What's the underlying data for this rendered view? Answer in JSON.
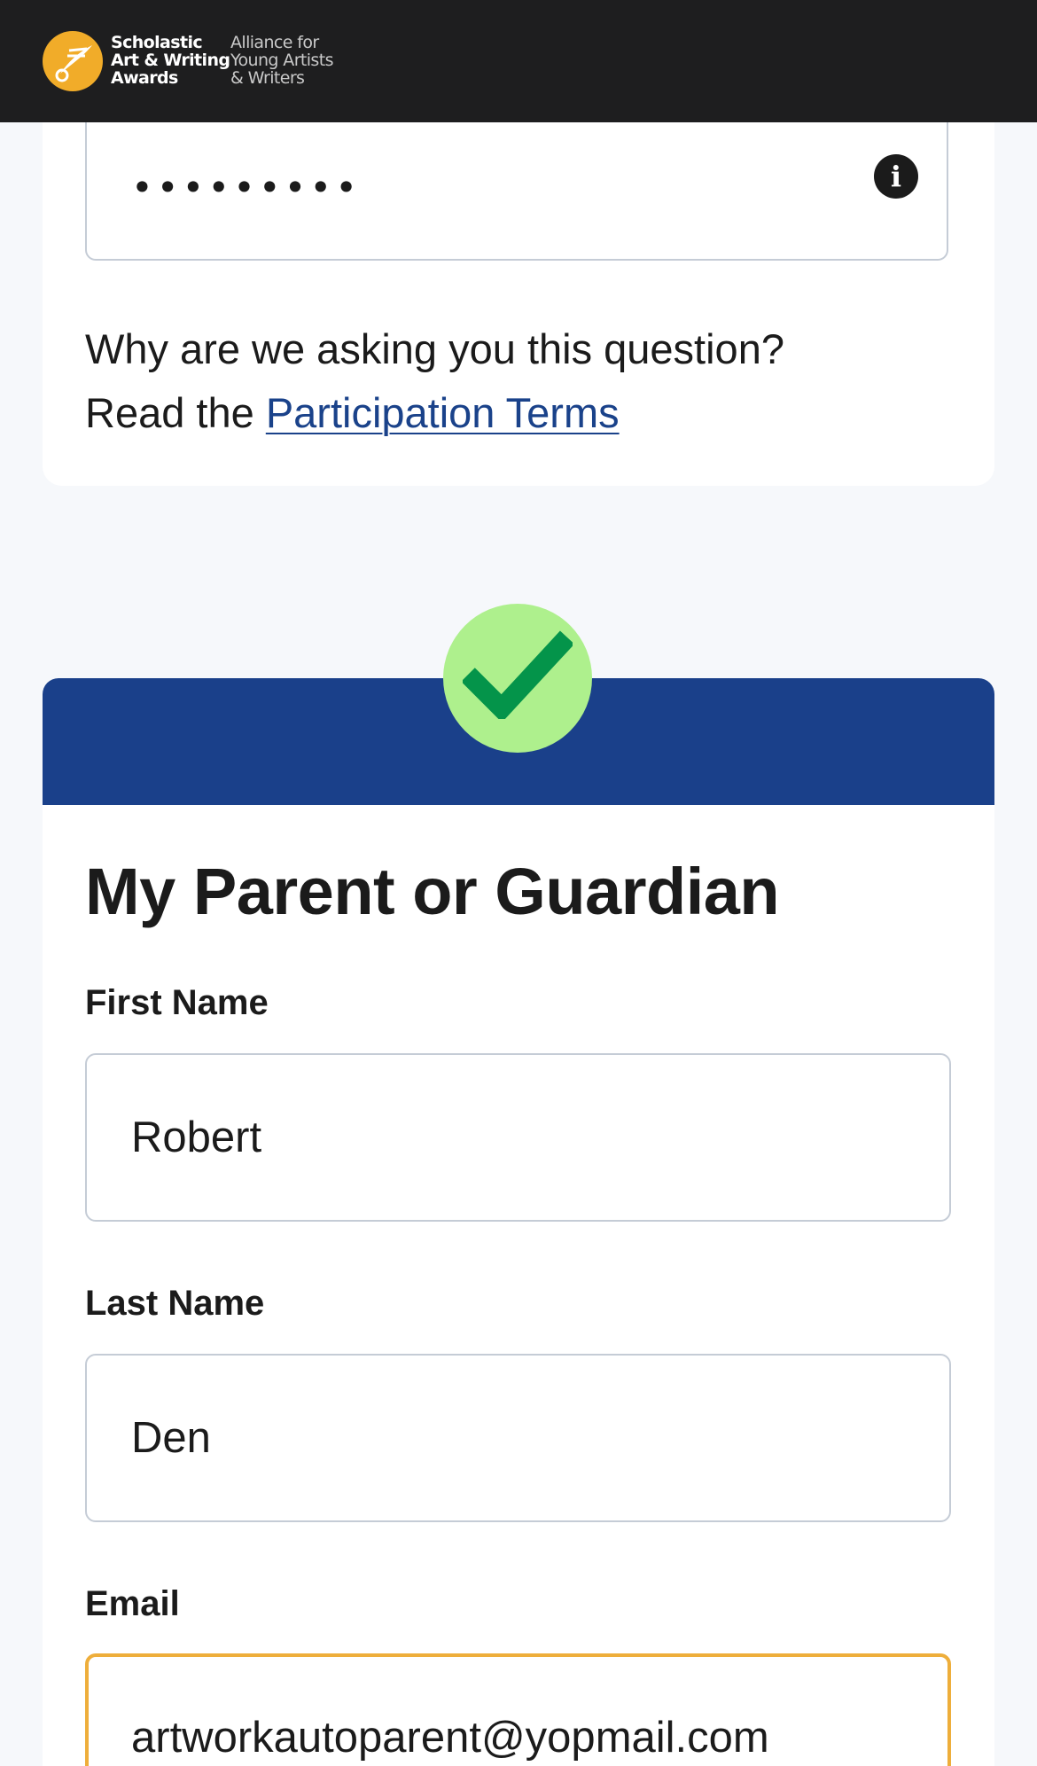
{
  "header": {
    "brand_line1": "Scholastic",
    "brand_line2": "Art & Writing",
    "brand_line3": "Awards",
    "tagline_line1": "Alliance for",
    "tagline_line2": "Young Artists",
    "tagline_line3": "& Writers"
  },
  "password_field": {
    "masked_value": "•••••••••",
    "info_glyph": "i"
  },
  "help": {
    "question": "Why are we asking you this question?",
    "read_prefix": "Read the ",
    "terms_link": "Participation Terms"
  },
  "guardian": {
    "status_icon": "checkmark-icon",
    "title": "My Parent or Guardian",
    "first_name": {
      "label": "First Name",
      "value": "Robert"
    },
    "last_name": {
      "label": "Last Name",
      "value": "Den"
    },
    "email": {
      "label": "Email",
      "value": "artworkautoparent@yopmail.com"
    }
  },
  "colors": {
    "header_bg": "#1e1e1f",
    "logo_yellow": "#f1ac29",
    "banner_blue": "#1a408a",
    "link_blue": "#1a428a",
    "check_bg": "#aef08d",
    "check_fg": "#04944a",
    "focus_border": "#eeae3b"
  }
}
